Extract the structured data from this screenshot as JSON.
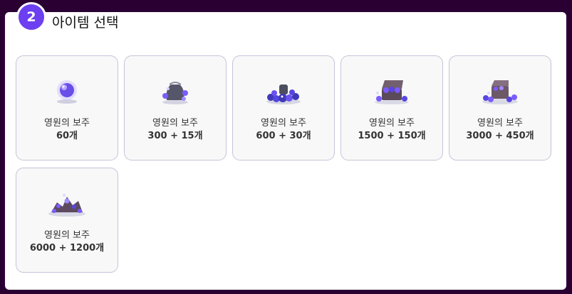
{
  "step": {
    "number": "2",
    "title": "아이템 선택"
  },
  "items": [
    {
      "name": "영원의 보주",
      "quantity": "60개",
      "icon": "single-orb-icon"
    },
    {
      "name": "영원의 보주",
      "quantity": "300 + 15개",
      "icon": "orb-pouch-icon"
    },
    {
      "name": "영원의 보주",
      "quantity": "600 + 30개",
      "icon": "orb-pile-icon"
    },
    {
      "name": "영원의 보주",
      "quantity": "1500 + 150개",
      "icon": "treasure-chest-icon"
    },
    {
      "name": "영원의 보주",
      "quantity": "3000 + 450개",
      "icon": "treasure-chest-large-icon"
    },
    {
      "name": "영원의 보주",
      "quantity": "6000 + 1200개",
      "icon": "orb-hoard-icon"
    }
  ],
  "colors": {
    "background": "#2a0033",
    "accent": "#6c3ff0",
    "card_border": "#c5c4d8",
    "orb": "#7b5cff"
  }
}
